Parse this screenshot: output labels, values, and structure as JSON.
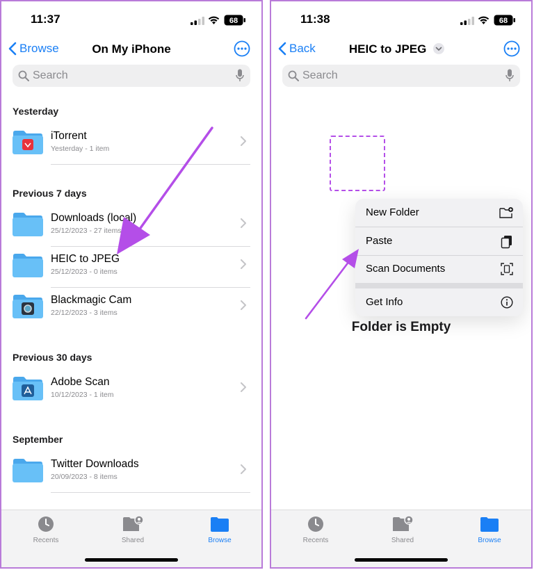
{
  "left": {
    "time": "11:37",
    "battery": "68",
    "back_label": "Browse",
    "title": "On My iPhone",
    "search_placeholder": "Search",
    "sections": [
      {
        "label": "Yesterday",
        "items": [
          {
            "name": "iTorrent",
            "meta": "Yesterday - 1 item",
            "badge": "itorrent"
          }
        ]
      },
      {
        "label": "Previous 7 days",
        "items": [
          {
            "name": "Downloads (local)",
            "meta": "25/12/2023 - 27 items",
            "badge": "none"
          },
          {
            "name": "HEIC to JPEG",
            "meta": "25/12/2023 - 0 items",
            "badge": "none"
          },
          {
            "name": "Blackmagic Cam",
            "meta": "22/12/2023 - 3 items",
            "badge": "camera"
          }
        ]
      },
      {
        "label": "Previous 30 days",
        "items": [
          {
            "name": "Adobe Scan",
            "meta": "10/12/2023 - 1 item",
            "badge": "adobe"
          }
        ]
      },
      {
        "label": "September",
        "items": [
          {
            "name": "Twitter Downloads",
            "meta": "20/09/2023 - 8 items",
            "badge": "none"
          }
        ]
      }
    ]
  },
  "right": {
    "time": "11:38",
    "battery": "68",
    "back_label": "Back",
    "title": "HEIC to JPEG",
    "search_placeholder": "Search",
    "menu": [
      {
        "label": "New Folder",
        "icon": "new-folder-icon"
      },
      {
        "label": "Paste",
        "icon": "paste-icon"
      },
      {
        "label": "Scan Documents",
        "icon": "scan-documents-icon"
      },
      {
        "label": "Get Info",
        "icon": "info-icon"
      }
    ],
    "empty_text": "Folder is Empty"
  },
  "tabs": [
    {
      "label": "Recents",
      "icon": "clock-icon",
      "active": false
    },
    {
      "label": "Shared",
      "icon": "shared-folder-icon",
      "active": false
    },
    {
      "label": "Browse",
      "icon": "folder-icon",
      "active": true
    }
  ],
  "colors": {
    "accent": "#1a7ff5",
    "folder": "#5bb8f5",
    "annotation": "#b44ee8"
  }
}
